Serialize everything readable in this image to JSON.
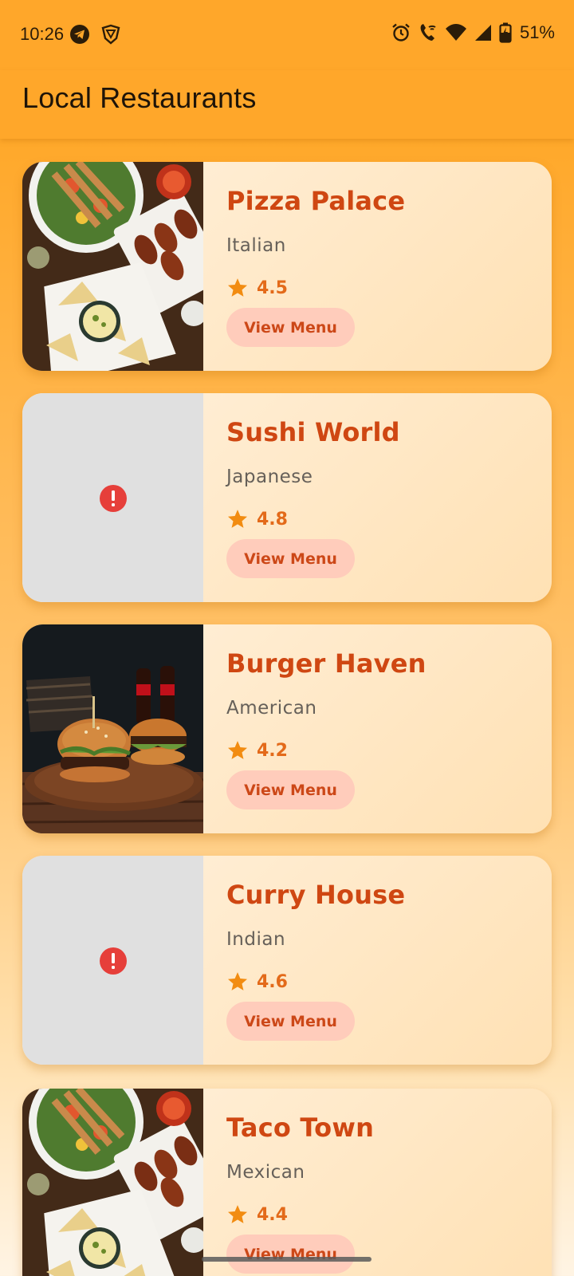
{
  "status_bar": {
    "time": "10:26",
    "left_icons": [
      "telegram-icon",
      "vpn-shield-icon"
    ],
    "right_icons": [
      "alarm-icon",
      "wifi-call-icon",
      "wifi-icon",
      "signal-icon",
      "battery-charging-icon"
    ],
    "battery": "51%"
  },
  "app_bar": {
    "title": "Local Restaurants"
  },
  "colors": {
    "app_bar": "#ffa72a",
    "name_text": "#cf4712",
    "rating_star": "#f28c11",
    "menu_button_bg": "#ffccbb",
    "error_icon": "#e63f3a"
  },
  "restaurants": [
    {
      "name": "Pizza Palace",
      "cuisine": "Italian",
      "rating": "4.5",
      "button": "View Menu",
      "image": "food-platter"
    },
    {
      "name": "Sushi World",
      "cuisine": "Japanese",
      "rating": "4.8",
      "button": "View Menu",
      "image": "error"
    },
    {
      "name": "Burger Haven",
      "cuisine": "American",
      "rating": "4.2",
      "button": "View Menu",
      "image": "burgers"
    },
    {
      "name": "Curry House",
      "cuisine": "Indian",
      "rating": "4.6",
      "button": "View Menu",
      "image": "error"
    },
    {
      "name": "Taco Town",
      "cuisine": "Mexican",
      "rating": "4.4",
      "button": "View Menu",
      "image": "food-platter"
    }
  ]
}
